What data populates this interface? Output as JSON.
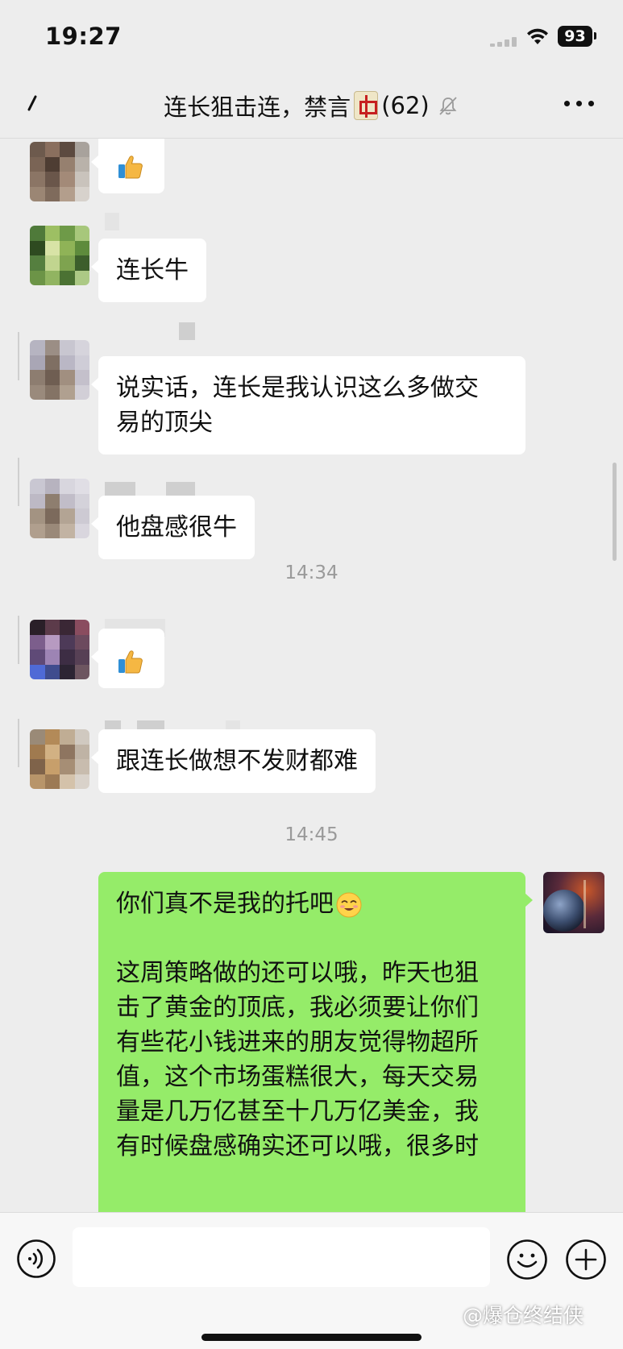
{
  "status_bar": {
    "time": "19:27",
    "battery": "93"
  },
  "header": {
    "title": "连长狙击连，禁言",
    "member_count": "(62)",
    "muted": true
  },
  "messages": [
    {
      "sender": "left",
      "type": "emoji",
      "icon": "thumbs-up-icon"
    },
    {
      "sender": "left",
      "type": "text",
      "text": "连长牛"
    },
    {
      "sender": "left",
      "type": "text",
      "lines": [
        "说实话，连长是我认识这么多做交",
        "易的顶尖"
      ]
    },
    {
      "sender": "left",
      "type": "text",
      "text": "他盘感很牛"
    },
    {
      "type": "timestamp",
      "text": "14:34"
    },
    {
      "sender": "left",
      "type": "emoji",
      "icon": "thumbs-up-icon"
    },
    {
      "sender": "left",
      "type": "text",
      "text": "跟连长做想不发财都难"
    },
    {
      "type": "timestamp",
      "text": "14:45"
    },
    {
      "sender": "self",
      "type": "text",
      "first_line": "你们真不是我的托吧",
      "first_line_emoji": "grinning-emoji",
      "lines": [
        "这周策略做的还可以哦，昨天也狙",
        "击了黄金的顶底，我必须要让你们",
        "有些花小钱进来的朋友觉得物超所",
        "值，这个市场蛋糕很大，每天交易",
        "量是几万亿甚至十几万亿美金，我",
        "有时候盘感确实还可以哦，很多时"
      ]
    }
  ],
  "input_bar": {
    "text": ""
  },
  "watermark": "@爆仓终结侠",
  "colors": {
    "background": "#ededed",
    "self_bubble": "#95ec69",
    "other_bubble": "#ffffff",
    "timestamp": "#9a9a9a"
  }
}
